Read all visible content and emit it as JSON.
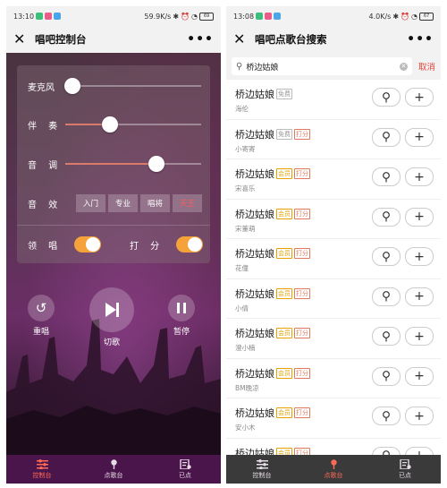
{
  "left": {
    "status": {
      "time": "13:10",
      "speed": "59.9K/s",
      "battery": "69"
    },
    "title": "唱吧控制台",
    "controls": {
      "mic": {
        "label": "麦克风",
        "value_percent": 5
      },
      "accomp": {
        "label": "伴 奏",
        "value_percent": 33
      },
      "pitch": {
        "label": "音 调",
        "value_percent": 67
      }
    },
    "effects": {
      "label": "音 效",
      "options": [
        "入门",
        "专业",
        "唱将",
        "天王"
      ],
      "selected": "天王"
    },
    "lead": {
      "label": "领 唱",
      "on": true
    },
    "score": {
      "label": "打 分",
      "on": true
    },
    "playback": {
      "replay": "重唱",
      "next": "切歌",
      "pause": "暂停"
    }
  },
  "right": {
    "status": {
      "time": "13:08",
      "speed": "4.0K/s",
      "battery": "67"
    },
    "title": "唱吧点歌台搜索",
    "search": {
      "value": "桥边姑娘",
      "cancel": "取消"
    },
    "songs": [
      {
        "name": "桥边姑娘",
        "tag1": "免费",
        "tag2": "",
        "singer": "海伦"
      },
      {
        "name": "桥边姑娘",
        "tag1": "免费",
        "tag2": "打分",
        "singer": "小寄寄"
      },
      {
        "name": "桥边姑娘",
        "tag1": "会员",
        "tag2": "打分",
        "singer": "宋喜乐"
      },
      {
        "name": "桥边姑娘",
        "tag1": "会员",
        "tag2": "打分",
        "singer": "宋董萌"
      },
      {
        "name": "桥边姑娘",
        "tag1": "会员",
        "tag2": "打分",
        "singer": "花僮"
      },
      {
        "name": "桥边姑娘",
        "tag1": "会员",
        "tag2": "打分",
        "singer": "小倩"
      },
      {
        "name": "桥边姑娘",
        "tag1": "会员",
        "tag2": "打分",
        "singer": "澄小楠"
      },
      {
        "name": "桥边姑娘",
        "tag1": "会员",
        "tag2": "打分",
        "singer": "BM晚凉"
      },
      {
        "name": "桥边姑娘",
        "tag1": "会员",
        "tag2": "打分",
        "singer": "安小木"
      },
      {
        "name": "桥边姑娘",
        "tag1": "会员",
        "tag2": "打分",
        "singer": ""
      }
    ]
  },
  "tabs": [
    "控制台",
    "点歌台",
    "已点"
  ],
  "colors": {
    "accent": "#ff6a57",
    "toggle": "#f5a23a",
    "tabbar": "#4a154b"
  }
}
